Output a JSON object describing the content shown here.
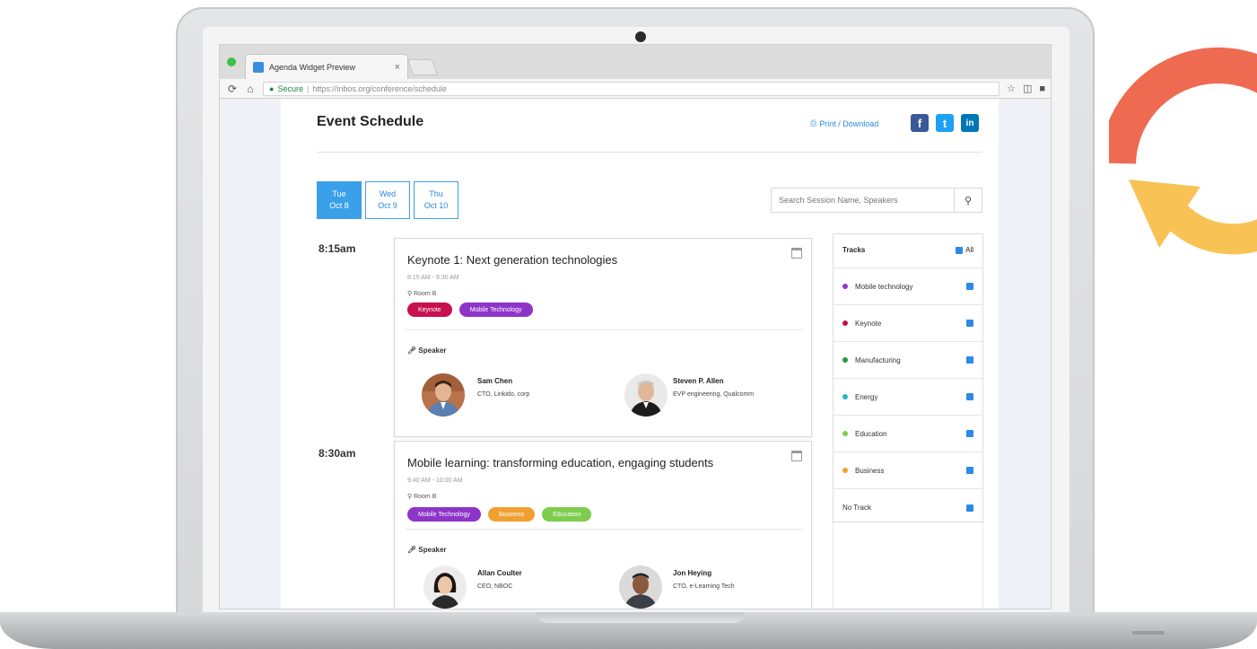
{
  "browser": {
    "tab_title": "Agenda Widget Preview",
    "tab_close": "×",
    "secure_label": "Secure",
    "url_separator": "|",
    "url": "https://inbos.org/conference/schedule"
  },
  "page": {
    "title": "Event Schedule",
    "print_label": "Print / Download",
    "social": {
      "facebook": "f",
      "twitter": "t",
      "linkedin": "in"
    }
  },
  "days": [
    {
      "weekday": "Tue",
      "date": "Oct 8",
      "active": true
    },
    {
      "weekday": "Wed",
      "date": "Oct 9",
      "active": false
    },
    {
      "weekday": "Thu",
      "date": "Oct 10",
      "active": false
    }
  ],
  "search": {
    "placeholder": "Search Session Name, Speakers"
  },
  "sessions": [
    {
      "time_label": "8:15am",
      "title": "Keynote 1: Next generation technologies",
      "time_range": "8:15 AM - 9:30 AM",
      "room": "Room B",
      "tags": [
        {
          "label": "Keynote",
          "color": "#c7104e"
        },
        {
          "label": "Mobile Technology",
          "color": "#8e35c9"
        }
      ],
      "speaker_heading": "Speaker",
      "speakers": [
        {
          "name": "Sam Chen",
          "role": "CTO, Linkido, corp"
        },
        {
          "name": "Steven P. Allen",
          "role": "EVP engineering, Qualcomm"
        }
      ]
    },
    {
      "time_label": "8:30am",
      "title": "Mobile learning: transforming education, engaging students",
      "time_range": "9:40 AM - 10:00 AM",
      "room": "Room B",
      "tags": [
        {
          "label": "Mobile Technology",
          "color": "#8e35c9"
        },
        {
          "label": "Business",
          "color": "#f0a030"
        },
        {
          "label": "Education",
          "color": "#7dcc4e"
        }
      ],
      "speaker_heading": "Speaker",
      "speakers": [
        {
          "name": "Allan Coulter",
          "role": "CEO, NBOC"
        },
        {
          "name": "Jon Heying",
          "role": "CTO, e-Learning Tech"
        }
      ]
    }
  ],
  "tracks": {
    "title": "Tracks",
    "all_label": "All",
    "items": [
      {
        "label": "Mobile technology",
        "color": "#8e35c9"
      },
      {
        "label": "Keynote",
        "color": "#c7104e"
      },
      {
        "label": "Manufacturing",
        "color": "#1f9d3a"
      },
      {
        "label": "Energy",
        "color": "#2bb3c7"
      },
      {
        "label": "Education",
        "color": "#7dcc4e"
      },
      {
        "label": "Business",
        "color": "#f0a030"
      },
      {
        "label": "No Track",
        "color": null
      }
    ]
  },
  "colors": {
    "accent": "#3aa0ea",
    "logo_red": "#ee6b52",
    "logo_yellow": "#f9c255"
  }
}
